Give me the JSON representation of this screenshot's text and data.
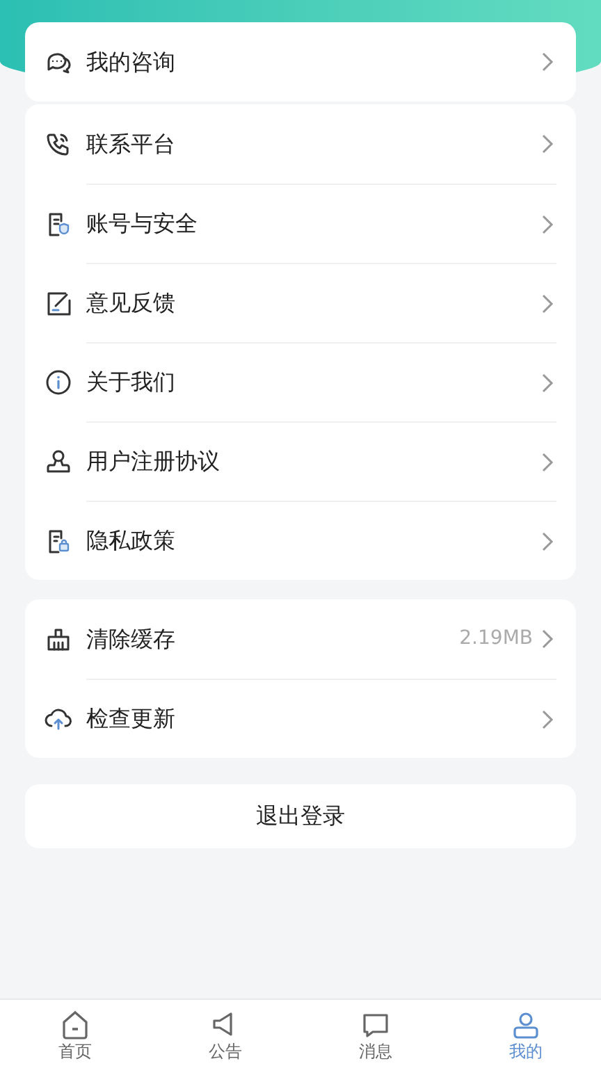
{
  "groups": [
    {
      "items": [
        {
          "label": "我的咨询"
        }
      ]
    },
    {
      "items": [
        {
          "label": "联系平台"
        },
        {
          "label": "账号与安全"
        },
        {
          "label": "意见反馈"
        },
        {
          "label": "关于我们"
        },
        {
          "label": "用户注册协议"
        },
        {
          "label": "隐私政策"
        }
      ]
    },
    {
      "items": [
        {
          "label": "清除缓存",
          "value": "2.19MB"
        },
        {
          "label": "检查更新"
        }
      ]
    }
  ],
  "logout_button": "退出登录",
  "bottom_nav": [
    {
      "label": "首页",
      "selected": false
    },
    {
      "label": "公告",
      "selected": false
    },
    {
      "label": "消息",
      "selected": false
    },
    {
      "label": "我的",
      "selected": true
    }
  ]
}
